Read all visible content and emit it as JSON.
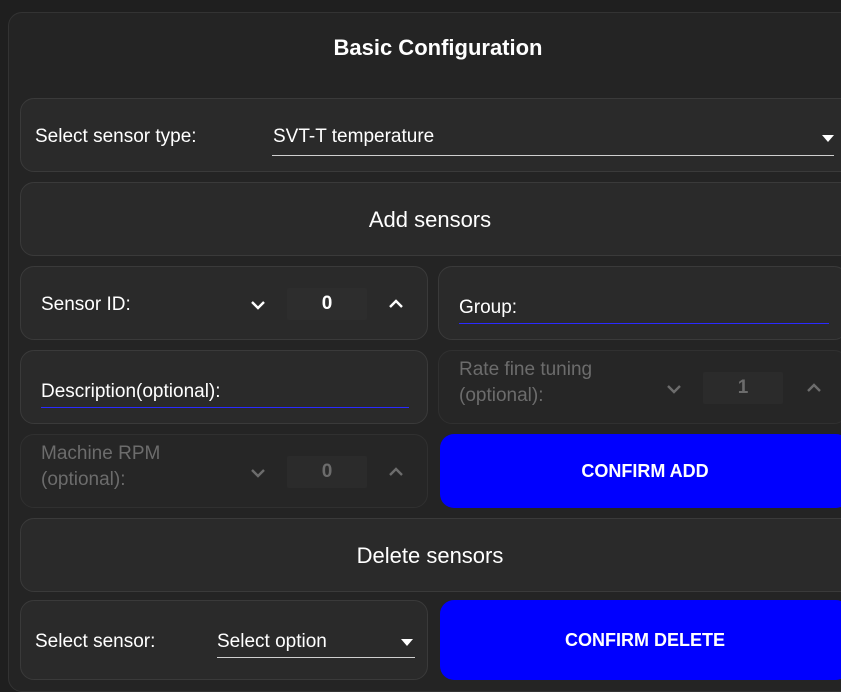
{
  "basic": {
    "title": "Basic Configuration"
  },
  "sensor_type": {
    "label": "Select sensor type:",
    "value": "SVT-T temperature"
  },
  "add_section": {
    "title": "Add sensors"
  },
  "sensor_id": {
    "label": "Sensor ID:",
    "value": "0"
  },
  "group": {
    "placeholder": "Group:"
  },
  "description": {
    "placeholder": "Description(optional):"
  },
  "rate_fine_tuning": {
    "label_line1": "Rate fine tuning",
    "label_line2": "(optional):",
    "value": "1"
  },
  "machine_rpm": {
    "label_line1": "Machine RPM",
    "label_line2": "(optional):",
    "value": "0"
  },
  "confirm_add": {
    "label": "CONFIRM ADD"
  },
  "delete_section": {
    "title": "Delete sensors"
  },
  "select_sensor": {
    "label": "Select sensor:",
    "value": "Select option"
  },
  "confirm_delete": {
    "label": "CONFIRM DELETE"
  },
  "colors": {
    "accent": "#0000ff",
    "panel": "#2a2a2a",
    "background": "#1f1f1f",
    "muted": "#6c6c6c"
  },
  "icons": [
    "chevron-down-icon",
    "chevron-up-icon",
    "dropdown-caret-icon"
  ]
}
